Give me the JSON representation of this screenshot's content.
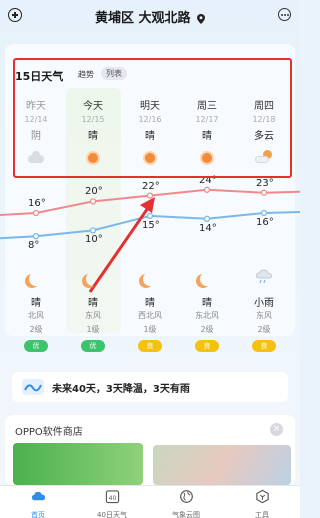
{
  "header": {
    "location": "黄埔区 大观北路"
  },
  "forecast": {
    "title": "15日天气",
    "tab_trend": "趋势",
    "tab_list": "列表",
    "days": [
      {
        "day": "昨天",
        "date": "12/14",
        "cond": "阴",
        "icon": "cloudy-icon"
      },
      {
        "day": "今天",
        "date": "12/15",
        "cond": "晴",
        "icon": "sun-icon"
      },
      {
        "day": "明天",
        "date": "12/16",
        "cond": "晴",
        "icon": "sun-icon"
      },
      {
        "day": "周三",
        "date": "12/17",
        "cond": "晴",
        "icon": "sun-icon"
      },
      {
        "day": "周四",
        "date": "12/18",
        "cond": "多云",
        "icon": "partly-cloudy-icon"
      }
    ],
    "highs": [
      "16°",
      "20°",
      "22°",
      "24°",
      "23°"
    ],
    "lows": [
      "8°",
      "10°",
      "15°",
      "14°",
      "16°"
    ],
    "high_values": [
      16,
      20,
      22,
      24,
      23
    ],
    "low_values": [
      8,
      10,
      15,
      14,
      16
    ],
    "nights": [
      {
        "cond": "晴",
        "wind": "北风",
        "level": "2级",
        "aqi": "优",
        "aqi_color": "#3cc36b"
      },
      {
        "cond": "晴",
        "wind": "东风",
        "level": "1级",
        "aqi": "优",
        "aqi_color": "#3cc36b"
      },
      {
        "cond": "晴",
        "wind": "西北风",
        "level": "1级",
        "aqi": "良",
        "aqi_color": "#f5c10f"
      },
      {
        "cond": "晴",
        "wind": "东北风",
        "level": "2级",
        "aqi": "良",
        "aqi_color": "#f5c10f"
      },
      {
        "cond": "小雨",
        "wind": "东风",
        "level": "2级",
        "aqi": "良",
        "aqi_color": "#f5c10f"
      }
    ]
  },
  "banner": {
    "text": "未来40天，3天降温，3天有雨"
  },
  "store": {
    "title": "OPPO软件商店"
  },
  "nav": {
    "items": [
      {
        "label": "首页",
        "icon": "home-cloud-icon"
      },
      {
        "label": "40日天气",
        "icon": "calendar-40-icon"
      },
      {
        "label": "气象云图",
        "icon": "globe-icon"
      },
      {
        "label": "工具",
        "icon": "tools-icon"
      }
    ]
  },
  "colors": {
    "accent": "#2f8fe8",
    "annotation": "#e43030",
    "high_line": "#f08a8a",
    "low_line": "#7ab8ea"
  }
}
